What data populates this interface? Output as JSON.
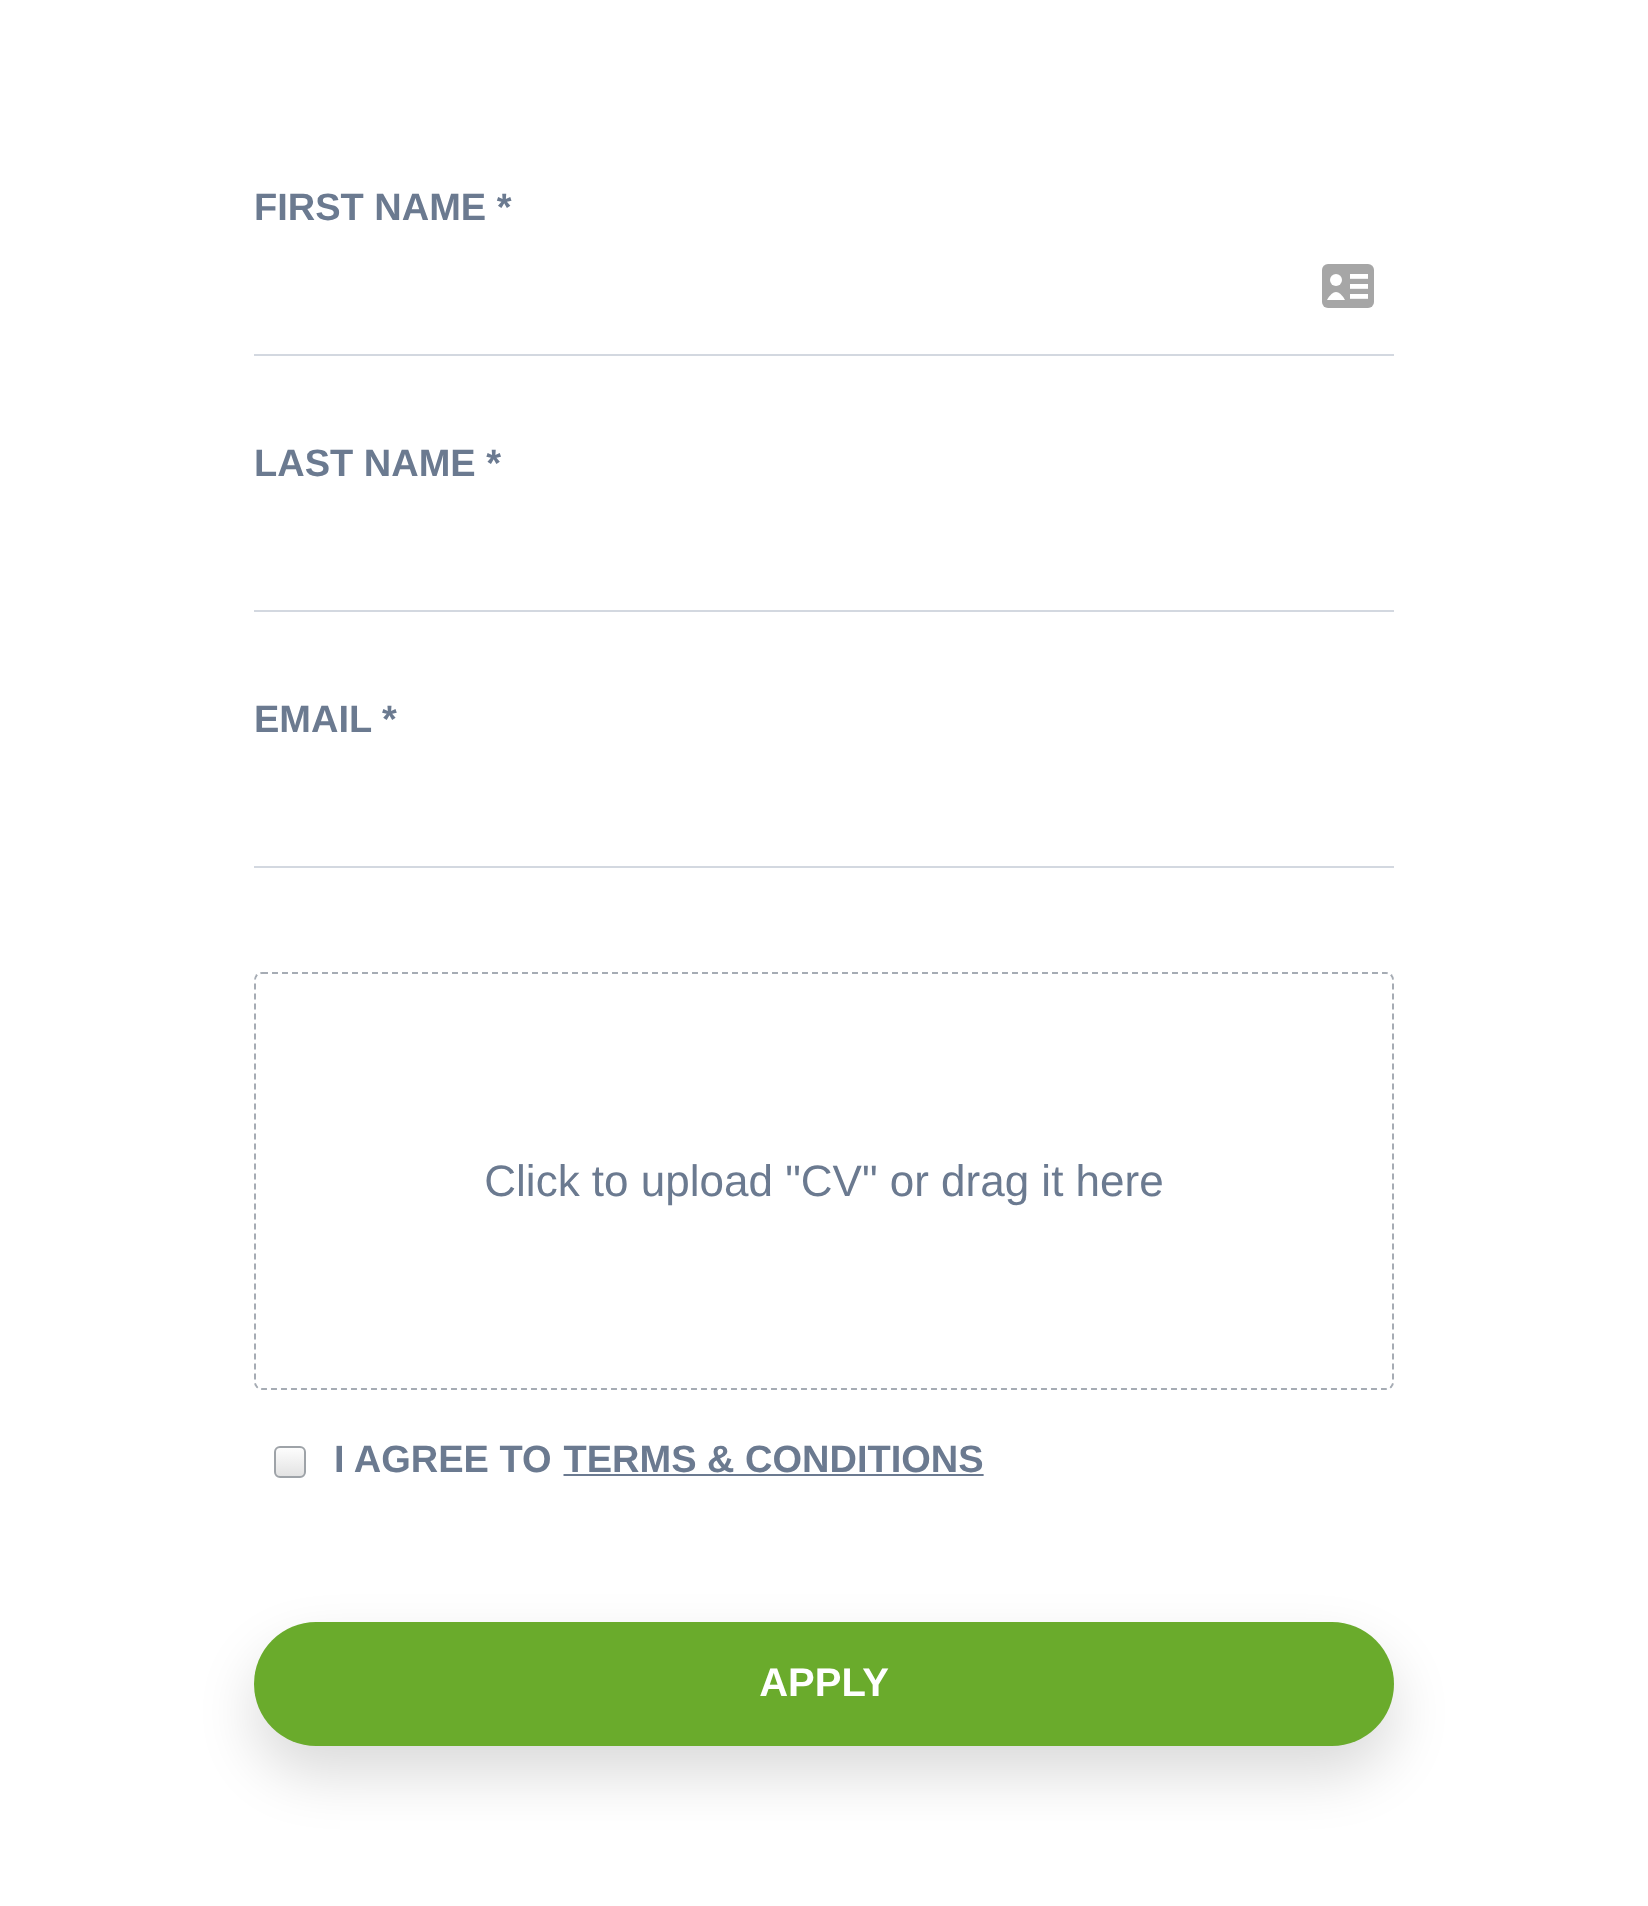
{
  "fields": [
    {
      "label": "FIRST NAME *",
      "kind": "contact"
    },
    {
      "label": "LAST NAME *",
      "kind": "plain"
    },
    {
      "label": "EMAIL *",
      "kind": "plain"
    }
  ],
  "upload": {
    "text": "Click to upload \"CV\" or drag it here"
  },
  "agreement": {
    "checked": false,
    "text": "I AGREE TO",
    "link": "TERMS & CONDITIONS"
  },
  "submit": {
    "label": "APPLY"
  }
}
